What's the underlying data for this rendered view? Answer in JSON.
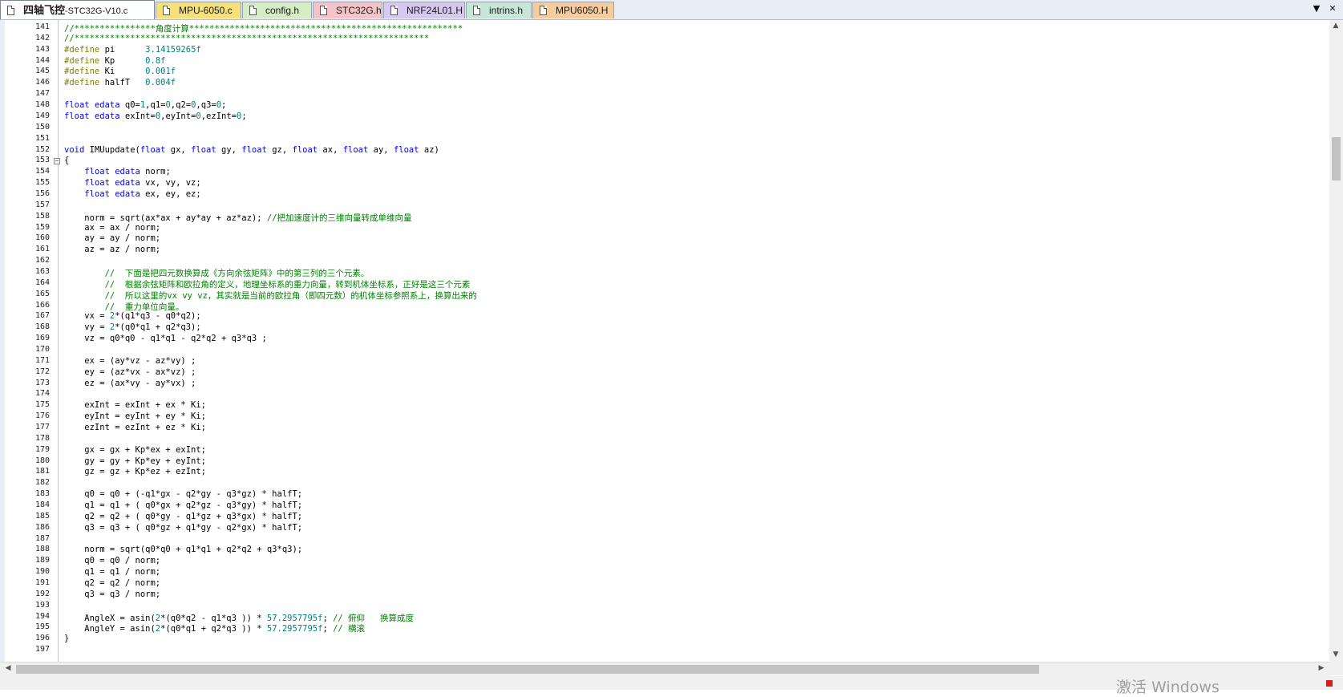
{
  "tabs": [
    {
      "label": "四轴飞控",
      "sub": "-STC32G-V10.c",
      "active": true,
      "color": "#ffffff"
    },
    {
      "label": "MPU-6050.c",
      "color": "#f5e079"
    },
    {
      "label": "config.h",
      "color": "#d6ecc4"
    },
    {
      "label": "STC32G.h",
      "color": "#f6c4c8"
    },
    {
      "label": "NRF24L01.H",
      "color": "#d6c8ef"
    },
    {
      "label": "intrins.h",
      "color": "#c6e6d6"
    },
    {
      "label": "MPU6050.H",
      "color": "#f7cc9c"
    }
  ],
  "tab_controls": {
    "dropdown": "▼",
    "close": "✕"
  },
  "colors": {
    "keyword": "#0000ff",
    "number": "#008080",
    "comment": "#008000",
    "preprocessor": "#808000"
  },
  "code_lines": [
    {
      "n": "141",
      "t": [
        [
          "com",
          "//****************角度计算******************************************************"
        ]
      ]
    },
    {
      "n": "142",
      "t": [
        [
          "com",
          "//**********************************************************************"
        ]
      ]
    },
    {
      "n": "143",
      "t": [
        [
          "pp",
          "#define"
        ],
        [
          "",
          " pi      "
        ],
        [
          "num",
          "3.14159265f"
        ]
      ]
    },
    {
      "n": "144",
      "t": [
        [
          "pp",
          "#define"
        ],
        [
          "",
          " Kp      "
        ],
        [
          "num",
          "0.8f"
        ]
      ]
    },
    {
      "n": "145",
      "t": [
        [
          "pp",
          "#define"
        ],
        [
          "",
          " Ki      "
        ],
        [
          "num",
          "0.001f"
        ]
      ]
    },
    {
      "n": "146",
      "t": [
        [
          "pp",
          "#define"
        ],
        [
          "",
          " halfT   "
        ],
        [
          "num",
          "0.004f"
        ]
      ]
    },
    {
      "n": "147",
      "t": []
    },
    {
      "n": "148",
      "t": [
        [
          "kw",
          "float"
        ],
        [
          "",
          " "
        ],
        [
          "kw",
          "edata"
        ],
        [
          "",
          " q0="
        ],
        [
          "num",
          "1"
        ],
        [
          "",
          ",q1="
        ],
        [
          "num",
          "0"
        ],
        [
          "",
          ",q2="
        ],
        [
          "num",
          "0"
        ],
        [
          "",
          ",q3="
        ],
        [
          "num",
          "0"
        ],
        [
          "",
          ";"
        ]
      ]
    },
    {
      "n": "149",
      "t": [
        [
          "kw",
          "float"
        ],
        [
          "",
          " "
        ],
        [
          "kw",
          "edata"
        ],
        [
          "",
          " exInt="
        ],
        [
          "num",
          "0"
        ],
        [
          "",
          ",eyInt="
        ],
        [
          "num",
          "0"
        ],
        [
          "",
          ",ezInt="
        ],
        [
          "num",
          "0"
        ],
        [
          "",
          ";"
        ]
      ]
    },
    {
      "n": "150",
      "t": []
    },
    {
      "n": "151",
      "t": []
    },
    {
      "n": "152",
      "t": [
        [
          "kw",
          "void"
        ],
        [
          "",
          " IMUupdate("
        ],
        [
          "kw",
          "float"
        ],
        [
          "",
          " gx, "
        ],
        [
          "kw",
          "float"
        ],
        [
          "",
          " gy, "
        ],
        [
          "kw",
          "float"
        ],
        [
          "",
          " gz, "
        ],
        [
          "kw",
          "float"
        ],
        [
          "",
          " ax, "
        ],
        [
          "kw",
          "float"
        ],
        [
          "",
          " ay, "
        ],
        [
          "kw",
          "float"
        ],
        [
          "",
          " az)"
        ]
      ]
    },
    {
      "n": "153",
      "fold": "−",
      "t": [
        [
          "",
          "{"
        ]
      ]
    },
    {
      "n": "154",
      "t": [
        [
          "",
          "    "
        ],
        [
          "kw",
          "float"
        ],
        [
          "",
          " "
        ],
        [
          "kw",
          "edata"
        ],
        [
          "",
          " norm;"
        ]
      ]
    },
    {
      "n": "155",
      "t": [
        [
          "",
          "    "
        ],
        [
          "kw",
          "float"
        ],
        [
          "",
          " "
        ],
        [
          "kw",
          "edata"
        ],
        [
          "",
          " vx, vy, vz;"
        ]
      ]
    },
    {
      "n": "156",
      "t": [
        [
          "",
          "    "
        ],
        [
          "kw",
          "float"
        ],
        [
          "",
          " "
        ],
        [
          "kw",
          "edata"
        ],
        [
          "",
          " ex, ey, ez;"
        ]
      ]
    },
    {
      "n": "157",
      "t": []
    },
    {
      "n": "158",
      "t": [
        [
          "",
          "    norm = sqrt(ax*ax + ay*ay + az*az); "
        ],
        [
          "com",
          "//把加速度计的三维向量转成单维向量"
        ]
      ]
    },
    {
      "n": "159",
      "t": [
        [
          "",
          "    ax = ax / norm;"
        ]
      ]
    },
    {
      "n": "160",
      "t": [
        [
          "",
          "    ay = ay / norm;"
        ]
      ]
    },
    {
      "n": "161",
      "t": [
        [
          "",
          "    az = az / norm;"
        ]
      ]
    },
    {
      "n": "162",
      "t": []
    },
    {
      "n": "163",
      "t": [
        [
          "",
          "        "
        ],
        [
          "com",
          "//  下面是把四元数换算成《方向余弦矩阵》中的第三列的三个元素。"
        ]
      ]
    },
    {
      "n": "164",
      "t": [
        [
          "",
          "        "
        ],
        [
          "com",
          "//  根据余弦矩阵和欧拉角的定义，地理坐标系的重力向量，转到机体坐标系，正好是这三个元素"
        ]
      ]
    },
    {
      "n": "165",
      "t": [
        [
          "",
          "        "
        ],
        [
          "com",
          "//  所以这里的vx vy vz，其实就是当前的欧拉角（即四元数）的机体坐标参照系上，换算出来的"
        ]
      ]
    },
    {
      "n": "166",
      "t": [
        [
          "",
          "        "
        ],
        [
          "com",
          "//  重力单位向量。"
        ]
      ]
    },
    {
      "n": "167",
      "t": [
        [
          "",
          "    vx = "
        ],
        [
          "num",
          "2"
        ],
        [
          "",
          "*(q1*q3 - q0*q2);"
        ]
      ]
    },
    {
      "n": "168",
      "t": [
        [
          "",
          "    vy = "
        ],
        [
          "num",
          "2"
        ],
        [
          "",
          "*(q0*q1 + q2*q3);"
        ]
      ]
    },
    {
      "n": "169",
      "t": [
        [
          "",
          "    vz = q0*q0 - q1*q1 - q2*q2 + q3*q3 ;"
        ]
      ]
    },
    {
      "n": "170",
      "t": []
    },
    {
      "n": "171",
      "t": [
        [
          "",
          "    ex = (ay*vz - az*vy) ;"
        ]
      ]
    },
    {
      "n": "172",
      "t": [
        [
          "",
          "    ey = (az*vx - ax*vz) ;"
        ]
      ]
    },
    {
      "n": "173",
      "t": [
        [
          "",
          "    ez = (ax*vy - ay*vx) ;"
        ]
      ]
    },
    {
      "n": "174",
      "t": []
    },
    {
      "n": "175",
      "t": [
        [
          "",
          "    exInt = exInt + ex * Ki;"
        ]
      ]
    },
    {
      "n": "176",
      "t": [
        [
          "",
          "    eyInt = eyInt + ey * Ki;"
        ]
      ]
    },
    {
      "n": "177",
      "t": [
        [
          "",
          "    ezInt = ezInt + ez * Ki;"
        ]
      ]
    },
    {
      "n": "178",
      "t": []
    },
    {
      "n": "179",
      "t": [
        [
          "",
          "    gx = gx + Kp*ex + exInt;"
        ]
      ]
    },
    {
      "n": "180",
      "t": [
        [
          "",
          "    gy = gy + Kp*ey + eyInt;"
        ]
      ]
    },
    {
      "n": "181",
      "t": [
        [
          "",
          "    gz = gz + Kp*ez + ezInt;"
        ]
      ]
    },
    {
      "n": "182",
      "t": []
    },
    {
      "n": "183",
      "t": [
        [
          "",
          "    q0 = q0 + (-q1*gx - q2*gy - q3*gz) * halfT;"
        ]
      ]
    },
    {
      "n": "184",
      "t": [
        [
          "",
          "    q1 = q1 + ( q0*gx + q2*gz - q3*gy) * halfT;"
        ]
      ]
    },
    {
      "n": "185",
      "t": [
        [
          "",
          "    q2 = q2 + ( q0*gy - q1*gz + q3*gx) * halfT;"
        ]
      ]
    },
    {
      "n": "186",
      "t": [
        [
          "",
          "    q3 = q3 + ( q0*gz + q1*gy - q2*gx) * halfT;"
        ]
      ]
    },
    {
      "n": "187",
      "t": []
    },
    {
      "n": "188",
      "t": [
        [
          "",
          "    norm = sqrt(q0*q0 + q1*q1 + q2*q2 + q3*q3);"
        ]
      ]
    },
    {
      "n": "189",
      "t": [
        [
          "",
          "    q0 = q0 / norm;"
        ]
      ]
    },
    {
      "n": "190",
      "t": [
        [
          "",
          "    q1 = q1 / norm;"
        ]
      ]
    },
    {
      "n": "191",
      "t": [
        [
          "",
          "    q2 = q2 / norm;"
        ]
      ]
    },
    {
      "n": "192",
      "t": [
        [
          "",
          "    q3 = q3 / norm;"
        ]
      ]
    },
    {
      "n": "193",
      "t": []
    },
    {
      "n": "194",
      "t": [
        [
          "",
          "    AngleX = asin("
        ],
        [
          "num",
          "2"
        ],
        [
          "",
          "*(q0*q2 - q1*q3 )) * "
        ],
        [
          "num",
          "57.2957795f"
        ],
        [
          "",
          "; "
        ],
        [
          "com",
          "// 俯仰   换算成度"
        ]
      ]
    },
    {
      "n": "195",
      "t": [
        [
          "",
          "    AngleY = asin("
        ],
        [
          "num",
          "2"
        ],
        [
          "",
          "*(q0*q1 + q2*q3 )) * "
        ],
        [
          "num",
          "57.2957795f"
        ],
        [
          "",
          "; "
        ],
        [
          "com",
          "// 横滚"
        ]
      ]
    },
    {
      "n": "196",
      "t": [
        [
          "",
          "}"
        ]
      ]
    },
    {
      "n": "197",
      "t": []
    }
  ],
  "watermark": "激活 Windows"
}
